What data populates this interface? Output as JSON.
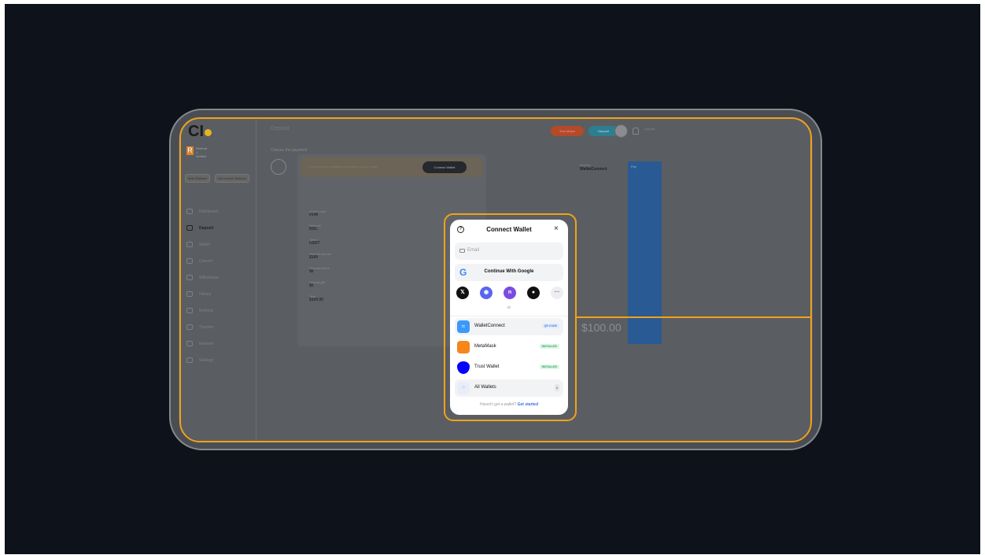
{
  "app": {
    "page_title": "Deposit",
    "choose_label": "Choose the payment",
    "header_buttons": {
      "red": "Tree Maker",
      "teal": "Deposit",
      "login": "Log out"
    }
  },
  "sidebar": {
    "logo_text": "CI",
    "user_initial": "R",
    "user_lines": [
      "Referral",
      "1",
      "Verified"
    ],
    "balances": [
      "Main Balance",
      "Bot Income Balance"
    ],
    "items": [
      {
        "label": "Dashboard",
        "active": false
      },
      {
        "label": "Deposit",
        "active": true
      },
      {
        "label": "Wallet",
        "active": false
      },
      {
        "label": "Convert",
        "active": false
      },
      {
        "label": "Withdrawal",
        "active": false
      },
      {
        "label": "History",
        "active": false
      },
      {
        "label": "Referral",
        "active": false
      },
      {
        "label": "Transfer",
        "active": false
      },
      {
        "label": "Network",
        "active": false
      },
      {
        "label": "Settings",
        "active": false
      }
    ]
  },
  "deposit_card": {
    "alert_text": "Your account is awaiting connection to your wallet",
    "connect_button": "Connect Wallet",
    "fields": [
      {
        "label": "Action code",
        "value": "#146"
      },
      {
        "label": "Network",
        "value": "BSC"
      },
      {
        "label": "Token",
        "value": "USDT"
      },
      {
        "label": "Deposit amount",
        "value": "$100"
      },
      {
        "label": "Deposit bonus",
        "value": "$0"
      },
      {
        "label": "Deposit gift",
        "value": "$0"
      },
      {
        "label": "Total",
        "value": "$100.00"
      }
    ],
    "method_label": "Method",
    "method_value": "WalletConnect",
    "amount_big": "$100.00",
    "blue_panel_label": "Pay"
  },
  "modal": {
    "title": "Connect Wallet",
    "close_symbol": "×",
    "help_symbol": "?",
    "email_placeholder": "Email",
    "google_label": "Continue With Google",
    "or_label": "or",
    "socials": [
      {
        "name": "x",
        "glyph": "𝕏"
      },
      {
        "name": "discord",
        "glyph": "◉"
      },
      {
        "name": "n",
        "glyph": "n"
      },
      {
        "name": "github",
        "glyph": "●"
      },
      {
        "name": "more",
        "glyph": "···"
      }
    ],
    "wallets": [
      {
        "name": "WalletConnect",
        "badge": "QR CODE",
        "badge_type": "qr"
      },
      {
        "name": "MetaMask",
        "badge": "INSTALLED",
        "badge_type": "installed"
      },
      {
        "name": "Trust Wallet",
        "badge": "INSTALLED",
        "badge_type": "installed"
      },
      {
        "name": "All Wallets",
        "badge": "8",
        "badge_type": "count"
      }
    ],
    "footer_text": "Haven't got a wallet?",
    "footer_link": "Get started"
  }
}
